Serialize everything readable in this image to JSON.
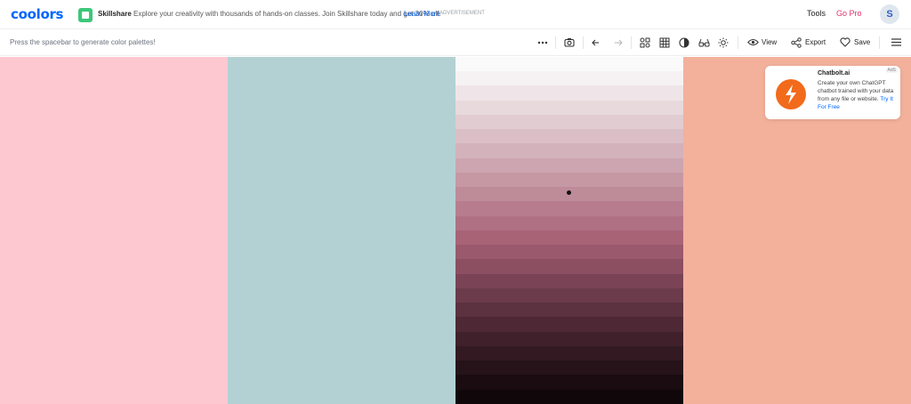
{
  "header": {
    "logo": "coolors",
    "ad": {
      "brand": "Skillshare",
      "text": "Explore your creativity with thousands of hands-on classes. Join Skillshare today and get 30% off.",
      "link": "Learn More",
      "tag": "ADVERTISEMENT"
    },
    "nav": {
      "tools": "Tools",
      "go_pro": "Go Pro"
    },
    "avatar_initial": "S"
  },
  "toolbar": {
    "hint": "Press the spacebar to generate color palettes!",
    "icons": [
      "more-icon",
      "camera-icon",
      "undo-icon",
      "redo-icon",
      "adjust-icon",
      "grid-icon",
      "contrast-icon",
      "glasses-icon",
      "brightness-icon",
      "eye-icon",
      "share-icon",
      "heart-icon",
      "menu-icon"
    ],
    "view_label": "View",
    "export_label": "Export",
    "save_label": "Save"
  },
  "palette": {
    "colors": [
      "#fec8d1",
      "#b3d1d2",
      "#b58397",
      "#f3b19c"
    ],
    "shades": [
      "#f6f2f3",
      "#efe5e8",
      "#e8d9dd",
      "#e1ccd2",
      "#dabfc6",
      "#d3b2bb",
      "#ccA5b0",
      "#c598a4",
      "#be8b99",
      "#b77d8e",
      "#b07083",
      "#a96377",
      "#9a596c",
      "#8c4e61",
      "#7a4456",
      "#6b3a4b",
      "#5c3140",
      "#4e2935",
      "#40212b",
      "#331a22",
      "#26131a",
      "#1a0c11",
      "#10070b"
    ],
    "shades_count_note": ""
  },
  "ad_card": {
    "badge": "AdS",
    "title": "Chatbolt.ai",
    "body": "Create your own ChatGPT chatbot trained with your data from any file or website.",
    "cta": "Try It For Free"
  }
}
